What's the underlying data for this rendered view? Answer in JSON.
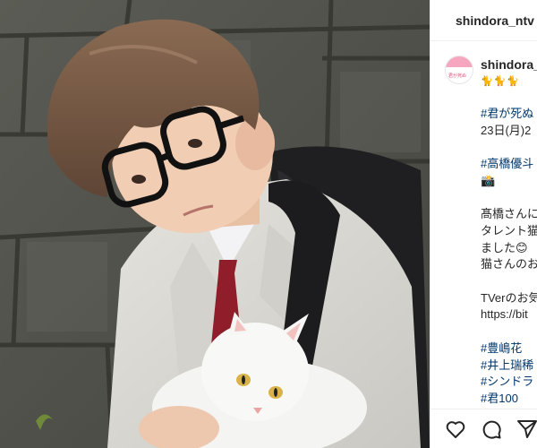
{
  "header": {
    "username": "shindora_ntv"
  },
  "post": {
    "avatar_caption": "君が死ぬ",
    "username": "shindora_",
    "emoji_line": "🐈🐈🐈",
    "caption_lines": [
      {
        "text": "#君が死ぬ",
        "type": "tag"
      },
      {
        "text": "23日(月)2",
        "type": "text"
      },
      {
        "text": "",
        "type": "blank"
      },
      {
        "text": "#高橋優斗",
        "type": "tag"
      },
      {
        "text": "📸",
        "type": "text"
      },
      {
        "text": "",
        "type": "blank"
      },
      {
        "text": "髙橋さんに",
        "type": "text"
      },
      {
        "text": "タレント猫",
        "type": "text"
      },
      {
        "text": "ました😊",
        "type": "text"
      },
      {
        "text": "猫さんのお",
        "type": "text"
      },
      {
        "text": "",
        "type": "blank"
      },
      {
        "text": "TVerのお気",
        "type": "text"
      },
      {
        "text": "https://bit",
        "type": "text"
      },
      {
        "text": "",
        "type": "blank"
      },
      {
        "text": "#豊嶋花",
        "type": "tag"
      },
      {
        "text": "#井上瑞稀",
        "type": "tag"
      },
      {
        "text": "#シンドラ",
        "type": "tag"
      },
      {
        "text": "#君100",
        "type": "tag"
      }
    ]
  },
  "icons": {
    "like": "heart-icon",
    "comment": "comment-icon",
    "share": "send-icon"
  }
}
